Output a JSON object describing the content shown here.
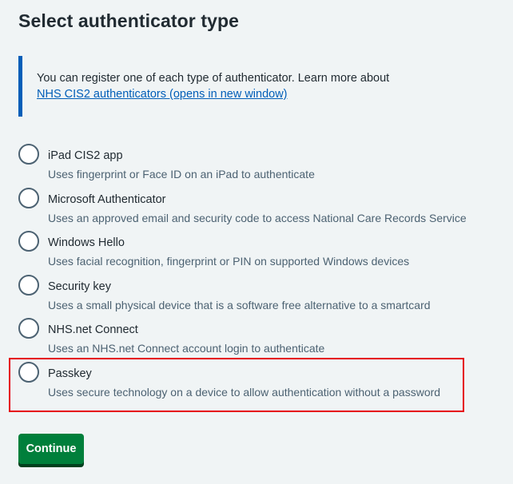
{
  "page": {
    "title": "Select authenticator type"
  },
  "inset": {
    "text": "You can register one of each type of authenticator. Learn more about",
    "link_text": "NHS CIS2 authenticators (opens in new window)"
  },
  "options": [
    {
      "label": "iPad CIS2 app",
      "hint": "Uses fingerprint or Face ID on an iPad to authenticate"
    },
    {
      "label": "Microsoft Authenticator",
      "hint": "Uses an approved email and security code to access National Care Records Service"
    },
    {
      "label": "Windows Hello",
      "hint": "Uses facial recognition, fingerprint or PIN on supported Windows devices"
    },
    {
      "label": "Security key",
      "hint": "Uses a small physical device that is a software free alternative to a smartcard"
    },
    {
      "label": "NHS.net Connect",
      "hint": "Uses an NHS.net Connect account login to authenticate"
    },
    {
      "label": "Passkey",
      "hint": "Uses secure technology on a device to allow authentication without a password"
    }
  ],
  "actions": {
    "continue_label": "Continue"
  },
  "colors": {
    "link": "#005eb8",
    "button": "#007f3b",
    "highlight": "#e5000f"
  }
}
